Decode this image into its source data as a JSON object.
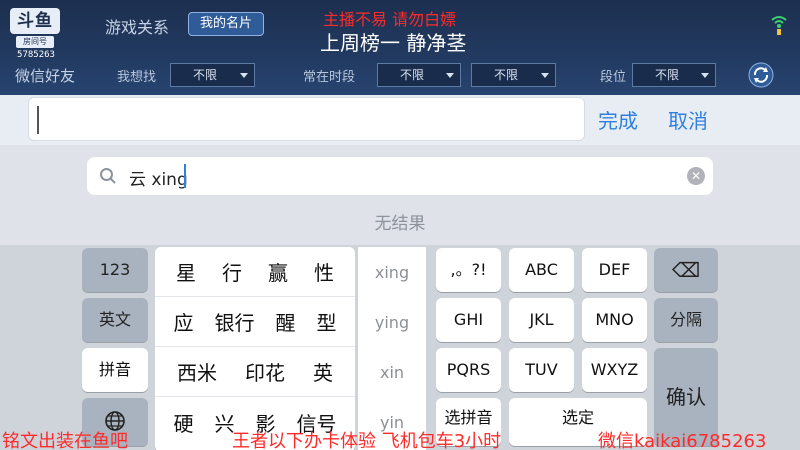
{
  "header": {
    "logo_mark": "斗鱼",
    "logo_label": "房间号",
    "room_number": "5785263",
    "nav_relations": "游戏关系",
    "nav_card": "我的名片",
    "overlay_top": "主播不易 请勿白嫖",
    "overlay_sub": "上周榜一 静净茎"
  },
  "filters": {
    "wechat_friends": "微信好友",
    "looking_for_label": "我想找",
    "looking_for_value": "不限",
    "active_time_label": "常在时段",
    "active_time_value_1": "不限",
    "active_time_value_2": "不限",
    "rank_label": "段位",
    "rank_value": "不限"
  },
  "input_bar": {
    "done_label": "完成",
    "cancel_label": "取消"
  },
  "search": {
    "query": "云 xing",
    "no_result": "无结果"
  },
  "keyboard": {
    "left_keys": [
      "123",
      "英文",
      "拼音"
    ],
    "candidates": [
      [
        "星",
        "行",
        "赢",
        "性"
      ],
      [
        "应",
        "银行",
        "醒",
        "型"
      ],
      [
        "西米",
        "印花",
        "英"
      ],
      [
        "硬",
        "兴",
        "影",
        "信号"
      ]
    ],
    "pinyin": [
      "xing",
      "ying",
      "xin",
      "yin"
    ],
    "letter_keys": [
      [
        ",。?!",
        "ABC",
        "DEF"
      ],
      [
        "GHI",
        "JKL",
        "MNO"
      ],
      [
        "PQRS",
        "TUV",
        "WXYZ"
      ]
    ],
    "bottom_keys": [
      "选拼音",
      "选定"
    ],
    "right_keys": {
      "backspace": "⌫",
      "segment": "分隔",
      "confirm": "确认"
    }
  },
  "captions": {
    "left": "铭文出装在鱼吧",
    "center": "王者以下办卡体验 飞机包车3小时",
    "right": "微信kaikai6785263"
  }
}
